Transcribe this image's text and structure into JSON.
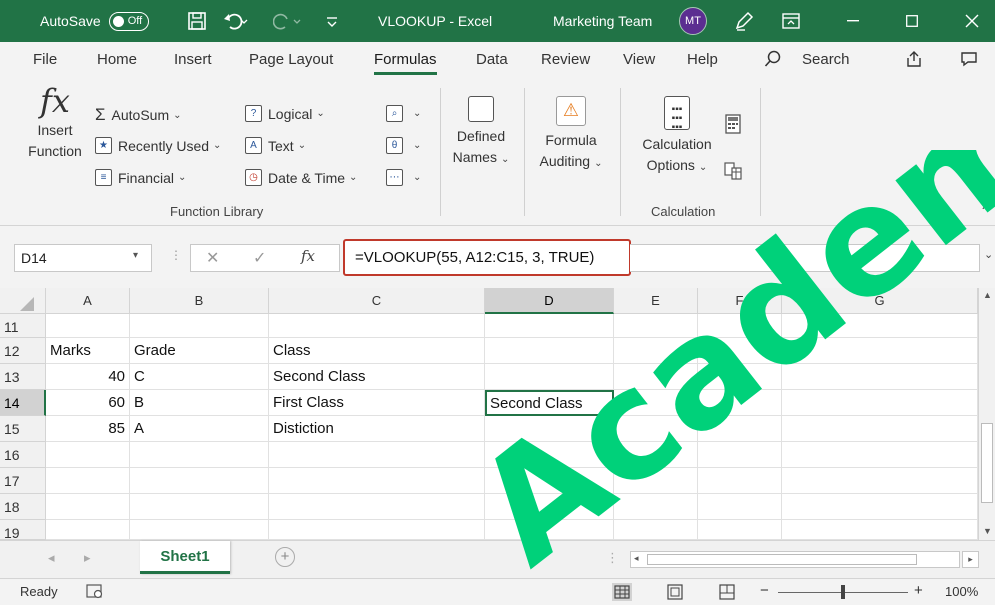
{
  "titlebar": {
    "autosave_label": "AutoSave",
    "autosave_state": "Off",
    "doc_title": "VLOOKUP - Excel",
    "team": "Marketing Team",
    "avatar_initials": "MT",
    "bg_color": "#217346"
  },
  "tabs": [
    "File",
    "Home",
    "Insert",
    "Page Layout",
    "Formulas",
    "Data",
    "Review",
    "View",
    "Help"
  ],
  "search_label": "Search",
  "ribbon": {
    "insert_function": [
      "Insert",
      "Function"
    ],
    "autosum": "AutoSum",
    "recently_used": "Recently Used",
    "financial": "Financial",
    "logical": "Logical",
    "text": "Text",
    "date_time": "Date & Time",
    "defined_names": [
      "Defined",
      "Names"
    ],
    "formula_auditing": [
      "Formula",
      "Auditing"
    ],
    "calculation_options": [
      "Calculation",
      "Options"
    ],
    "group_function_library": "Function Library",
    "group_calculation": "Calculation"
  },
  "formula_bar": {
    "name_box": "D14",
    "formula": "=VLOOKUP(55, A12:C15, 3, TRUE)"
  },
  "grid": {
    "columns": [
      "A",
      "B",
      "C",
      "D",
      "E",
      "F",
      "G"
    ],
    "selected_column": "D",
    "rows": [
      "11",
      "12",
      "13",
      "14",
      "15",
      "16",
      "17",
      "18",
      "19"
    ],
    "selected_row": "14",
    "cells": {
      "A12": "Marks",
      "B12": "Grade",
      "C12": "Class",
      "A13": "40",
      "B13": "C",
      "C13": "Second Class",
      "A14": "60",
      "B14": "B",
      "C14": "First Class",
      "D14": "Second Class",
      "A15": "85",
      "B15": "A",
      "C15": "Distiction"
    }
  },
  "sheets": [
    "Sheet1"
  ],
  "status": {
    "ready": "Ready",
    "zoom": "100%"
  },
  "watermark": "Academy",
  "watermark_color": "#00d17a"
}
